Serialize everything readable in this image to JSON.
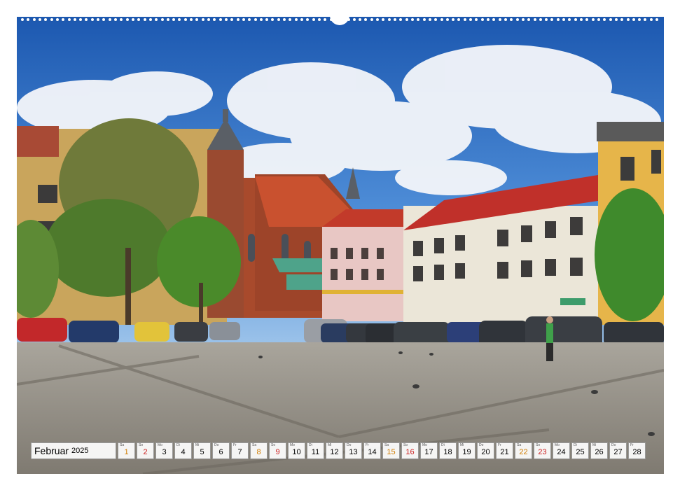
{
  "calendar": {
    "month": "Februar",
    "year": "2025",
    "days": [
      {
        "wd": "Sa",
        "num": "1",
        "type": "sat"
      },
      {
        "wd": "So",
        "num": "2",
        "type": "sun"
      },
      {
        "wd": "Mo",
        "num": "3",
        "type": "wk"
      },
      {
        "wd": "Di",
        "num": "4",
        "type": "wk"
      },
      {
        "wd": "Mi",
        "num": "5",
        "type": "wk"
      },
      {
        "wd": "Do",
        "num": "6",
        "type": "wk"
      },
      {
        "wd": "Fr",
        "num": "7",
        "type": "wk"
      },
      {
        "wd": "Sa",
        "num": "8",
        "type": "sat"
      },
      {
        "wd": "So",
        "num": "9",
        "type": "sun"
      },
      {
        "wd": "Mo",
        "num": "10",
        "type": "wk"
      },
      {
        "wd": "Di",
        "num": "11",
        "type": "wk"
      },
      {
        "wd": "Mi",
        "num": "12",
        "type": "wk"
      },
      {
        "wd": "Do",
        "num": "13",
        "type": "wk"
      },
      {
        "wd": "Fr",
        "num": "14",
        "type": "wk"
      },
      {
        "wd": "Sa",
        "num": "15",
        "type": "sat"
      },
      {
        "wd": "So",
        "num": "16",
        "type": "sun"
      },
      {
        "wd": "Mo",
        "num": "17",
        "type": "wk"
      },
      {
        "wd": "Di",
        "num": "18",
        "type": "wk"
      },
      {
        "wd": "Mi",
        "num": "19",
        "type": "wk"
      },
      {
        "wd": "Do",
        "num": "20",
        "type": "wk"
      },
      {
        "wd": "Fr",
        "num": "21",
        "type": "wk"
      },
      {
        "wd": "Sa",
        "num": "22",
        "type": "sat"
      },
      {
        "wd": "So",
        "num": "23",
        "type": "sun"
      },
      {
        "wd": "Mo",
        "num": "24",
        "type": "wk"
      },
      {
        "wd": "Di",
        "num": "25",
        "type": "wk"
      },
      {
        "wd": "Mi",
        "num": "26",
        "type": "wk"
      },
      {
        "wd": "Do",
        "num": "27",
        "type": "wk"
      },
      {
        "wd": "Fr",
        "num": "28",
        "type": "wk"
      }
    ]
  },
  "colors": {
    "sky_top": "#1f5fb8",
    "sky_bottom": "#7fb0e6",
    "brick": "#a94a2c",
    "roof_red": "#c23a2a",
    "facade_yellow": "#e3b64e",
    "facade_cream": "#e9e4d6",
    "cobblestone": "#8f8a82",
    "saturday": "#d07c00",
    "sunday": "#cc1f1f"
  },
  "scene": {
    "subject": "town square with gothic brick church, colourful townhouses, parked cars, trees and cobblestone plaza"
  }
}
